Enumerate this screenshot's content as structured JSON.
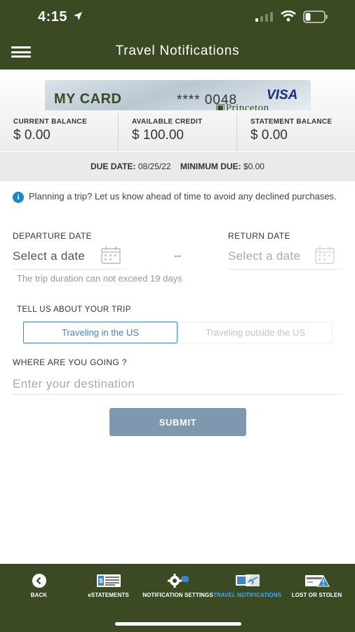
{
  "status_bar": {
    "time": "4:15"
  },
  "header": {
    "title": "Travel Notifications"
  },
  "card": {
    "name": "MY CARD",
    "number": "**** 0048",
    "network": "VISA",
    "bank": "Princeton"
  },
  "balances": [
    {
      "label": "CURRENT BALANCE",
      "value": "$ 0.00"
    },
    {
      "label": "AVAILABLE CREDIT",
      "value": "$ 100.00"
    },
    {
      "label": "STATEMENT BALANCE",
      "value": "$ 0.00"
    }
  ],
  "due": {
    "due_label": "DUE DATE:",
    "due_value": "08/25/22",
    "min_label": "MINIMUM DUE:",
    "min_value": "$0.00"
  },
  "info_text": "Planning a trip? Let us know ahead of time to avoid any declined purchases.",
  "form": {
    "departure_label": "DEPARTURE DATE",
    "departure_placeholder": "Select a date",
    "separator": "--",
    "return_label": "RETURN DATE",
    "return_placeholder": "Select a date",
    "duration_hint": "The trip duration can not exceed 19 days",
    "trip_label": "TELL US ABOUT YOUR TRIP",
    "option_us": "Traveling in the US",
    "option_outside": "Traveling outside the US",
    "destination_label": "WHERE ARE YOU GOING ?",
    "destination_placeholder": "Enter your destination",
    "submit_label": "SUBMIT"
  },
  "tabs": [
    {
      "label": "BACK",
      "icon": "back-icon",
      "active": false
    },
    {
      "label": "eSTATEMENTS",
      "icon": "statements-icon",
      "active": false
    },
    {
      "label": "NOTIFICATION SETTINGS",
      "icon": "notification-settings-icon",
      "active": false
    },
    {
      "label": "TRAVEL NOTIFICATIONS",
      "icon": "travel-icon",
      "active": true
    },
    {
      "label": "LOST OR STOLEN",
      "icon": "lost-stolen-icon",
      "active": false
    }
  ],
  "colors": {
    "brand": "#3b4a22",
    "accent": "#3d86c6",
    "active_tab": "#4da8e6",
    "submit": "#7f98b0"
  }
}
